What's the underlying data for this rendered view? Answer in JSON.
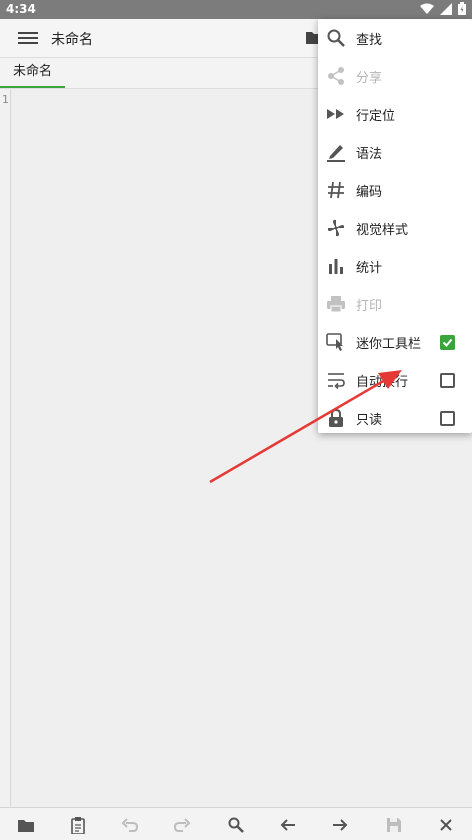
{
  "status": {
    "time": "4:34"
  },
  "toolbar": {
    "title": "未命名"
  },
  "tabs": [
    {
      "label": "未命名"
    }
  ],
  "editor": {
    "line_number": "1"
  },
  "menu": {
    "items": [
      {
        "label": "查找",
        "icon": "search-icon",
        "enabled": true
      },
      {
        "label": "分享",
        "icon": "share-icon",
        "enabled": false
      },
      {
        "label": "行定位",
        "icon": "fast-forward-icon",
        "enabled": true
      },
      {
        "label": "语法",
        "icon": "pen-icon",
        "enabled": true
      },
      {
        "label": "编码",
        "icon": "hash-icon",
        "enabled": true
      },
      {
        "label": "视觉样式",
        "icon": "pinwheel-icon",
        "enabled": true
      },
      {
        "label": "统计",
        "icon": "bar-chart-icon",
        "enabled": true
      },
      {
        "label": "打印",
        "icon": "printer-icon",
        "enabled": false
      },
      {
        "label": "迷你工具栏",
        "icon": "touch-icon",
        "enabled": true,
        "checked": true
      },
      {
        "label": "自动换行",
        "icon": "wrap-icon",
        "enabled": true,
        "checked": false
      },
      {
        "label": "只读",
        "icon": "lock-icon",
        "enabled": true,
        "checked": false
      }
    ]
  },
  "colors": {
    "accent": "#3aa63a",
    "annotation_arrow": "#e53935"
  },
  "bottom_bar": {
    "icons": [
      "folder-icon",
      "clipboard-icon",
      "undo-icon",
      "redo-icon",
      "search-icon",
      "arrow-left-icon",
      "arrow-right-icon",
      "save-icon",
      "close-icon"
    ]
  }
}
